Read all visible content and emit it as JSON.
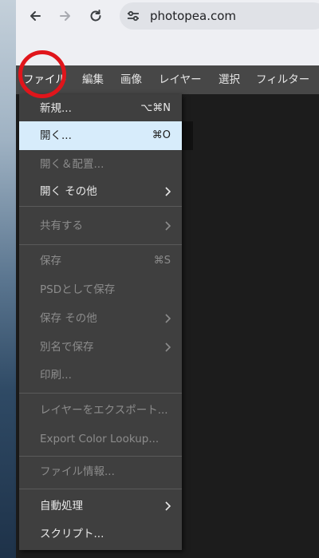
{
  "browser": {
    "url": "photopea.com",
    "icons": [
      "back-arrow-icon",
      "forward-arrow-icon",
      "reload-icon",
      "site-settings-icon"
    ]
  },
  "menubar": {
    "items": [
      "ファイル",
      "編集",
      "画像",
      "レイヤー",
      "選択",
      "フィルター"
    ],
    "active_index": 0
  },
  "file_menu": {
    "items": [
      {
        "label": "新規...",
        "shortcut": "⌥⌘N",
        "enabled": true
      },
      {
        "label": "開く...",
        "shortcut": "⌘O",
        "enabled": true,
        "selected": true
      },
      {
        "label": "開く＆配置...",
        "shortcut": "",
        "enabled": false
      },
      {
        "label": "開く その他",
        "shortcut": "",
        "enabled": true,
        "submenu": true
      },
      {
        "label": "共有する",
        "shortcut": "",
        "enabled": false,
        "submenu": true
      },
      {
        "label": "保存",
        "shortcut": "⌘S",
        "enabled": false
      },
      {
        "label": "PSDとして保存",
        "shortcut": "",
        "enabled": false
      },
      {
        "label": "保存 その他",
        "shortcut": "",
        "enabled": false,
        "submenu": true
      },
      {
        "label": "別名で保存",
        "shortcut": "",
        "enabled": false,
        "submenu": true
      },
      {
        "label": "印刷...",
        "shortcut": "",
        "enabled": false
      },
      {
        "label": "レイヤーをエクスポート...",
        "shortcut": "",
        "enabled": false
      },
      {
        "label": "Export Color Lookup...",
        "shortcut": "",
        "enabled": false
      },
      {
        "label": "ファイル情報...",
        "shortcut": "",
        "enabled": false
      },
      {
        "label": "自動処理",
        "shortcut": "",
        "enabled": true,
        "submenu": true
      },
      {
        "label": "スクリプト...",
        "shortcut": "",
        "enabled": true
      }
    ]
  },
  "colors": {
    "menubar_bg": "#474747",
    "menu_bg": "#3f3f3f",
    "selected_bg": "#d7ecfb",
    "highlight_ring": "#e0151b"
  }
}
